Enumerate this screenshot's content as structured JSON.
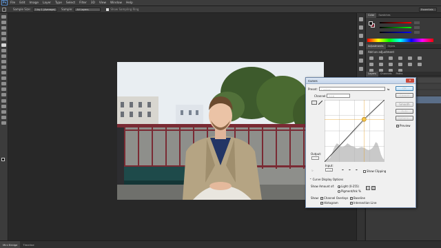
{
  "menubar": {
    "logo": "Ps",
    "items": [
      "File",
      "Edit",
      "Image",
      "Layer",
      "Type",
      "Select",
      "Filter",
      "3D",
      "View",
      "Window",
      "Help"
    ]
  },
  "options": {
    "sample_size_label": "Sample Size:",
    "sample_size_value": "1 by 1 (Average)",
    "sample_label": "Sample:",
    "sample_value": "All Layers",
    "show_ring_label": "Show Sampling Ring",
    "workspace": "Essentials"
  },
  "panels": {
    "color_tabs": [
      "Color",
      "Swatches"
    ],
    "adjustments_tabs": [
      "Adjustments",
      "Styles"
    ],
    "adjustments_title": "Add an adjustment",
    "layers_tabs": [
      "Layers",
      "Channels",
      "Paths"
    ]
  },
  "status": {
    "tabs": [
      "Mini Bridge",
      "Timeline"
    ]
  },
  "colors": {
    "fg": "#111111",
    "bg": "#7a1f2e",
    "accent": "#e59a1a"
  },
  "curves": {
    "title": "Curves",
    "preset_label": "Preset:",
    "preset_value": "Custom",
    "channel_label": "Channel:",
    "channel_value": "RGB",
    "output_label": "Output:",
    "output_value": "175",
    "input_label": "Input:",
    "input_value": "168",
    "show_clipping": "Show Clipping",
    "curve_display_options": "Curve Display Options",
    "show_amount_of": "Show Amount of:",
    "light_option": "Light  (0-255)",
    "pigment_option": "Pigment/Ink %",
    "show_label": "Show:",
    "channel_overlays": "Channel Overlays",
    "baseline": "Baseline",
    "histogram": "Histogram",
    "intersection_line": "Intersection Line",
    "buttons": {
      "ok": "OK",
      "cancel": "Cancel",
      "smooth": "Smooth",
      "auto": "Auto",
      "options": "Options...",
      "preview": "Preview"
    },
    "curve_point": {
      "input": 168,
      "output": 175
    },
    "histogram_values": [
      0.02,
      0.03,
      0.05,
      0.06,
      0.12,
      0.2,
      0.26,
      0.3,
      0.28,
      0.25,
      0.24,
      0.25,
      0.27,
      0.3,
      0.28,
      0.26,
      0.25,
      0.24,
      0.22,
      0.22,
      0.23,
      0.24,
      0.23,
      0.22,
      0.2,
      0.19,
      0.2,
      0.22,
      0.26,
      0.32,
      0.3,
      0.22,
      0.12,
      0.06,
      0.03
    ]
  }
}
